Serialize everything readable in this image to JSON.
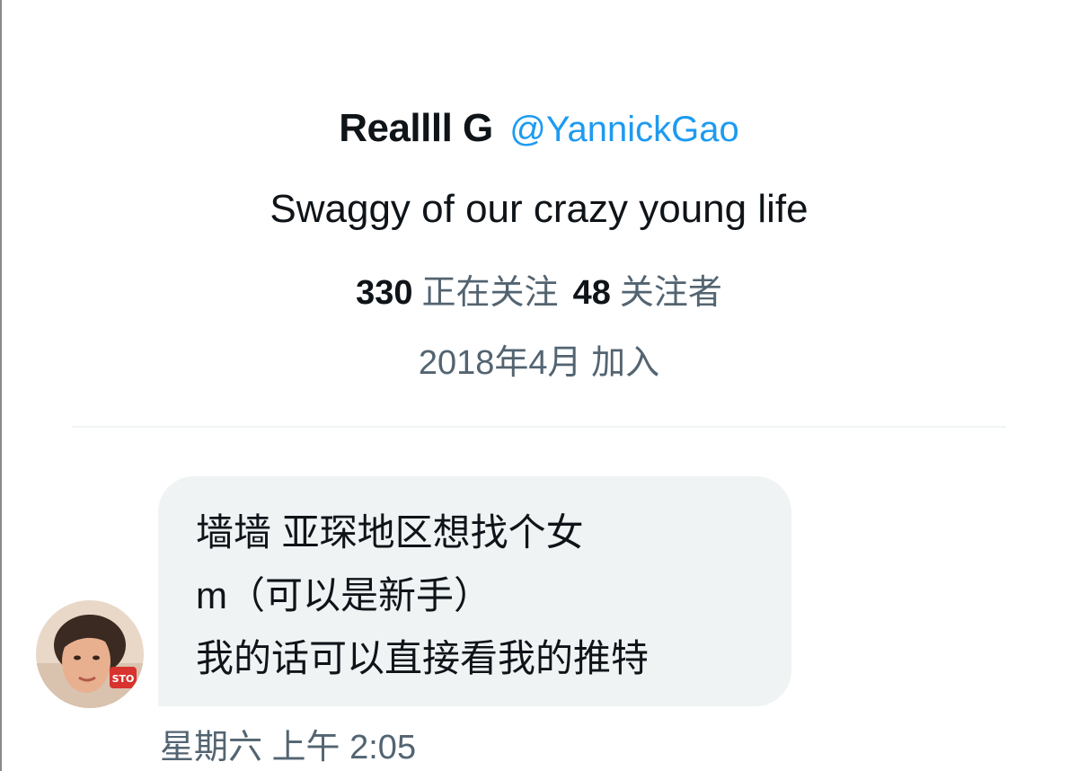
{
  "profile": {
    "display_name": "Reallll G",
    "handle": "@YannickGao",
    "bio": "Swaggy of our crazy young life",
    "following_count": "330",
    "following_label": "正在关注",
    "followers_count": "48",
    "followers_label": "关注者",
    "joined": "2018年4月 加入"
  },
  "conversation": {
    "message": {
      "lines": [
        "墙墙 亚琛地区想找个女",
        "m（可以是新手）",
        "我的话可以直接看我的推特"
      ],
      "timestamp": "星期六 上午 2:05"
    },
    "sender_avatar_sign_text": "STO"
  },
  "colors": {
    "text_primary": "#0f1419",
    "text_secondary": "#536471",
    "accent": "#1d9bf0",
    "bubble_bg": "#eff3f4",
    "divider": "#eff3f4"
  }
}
